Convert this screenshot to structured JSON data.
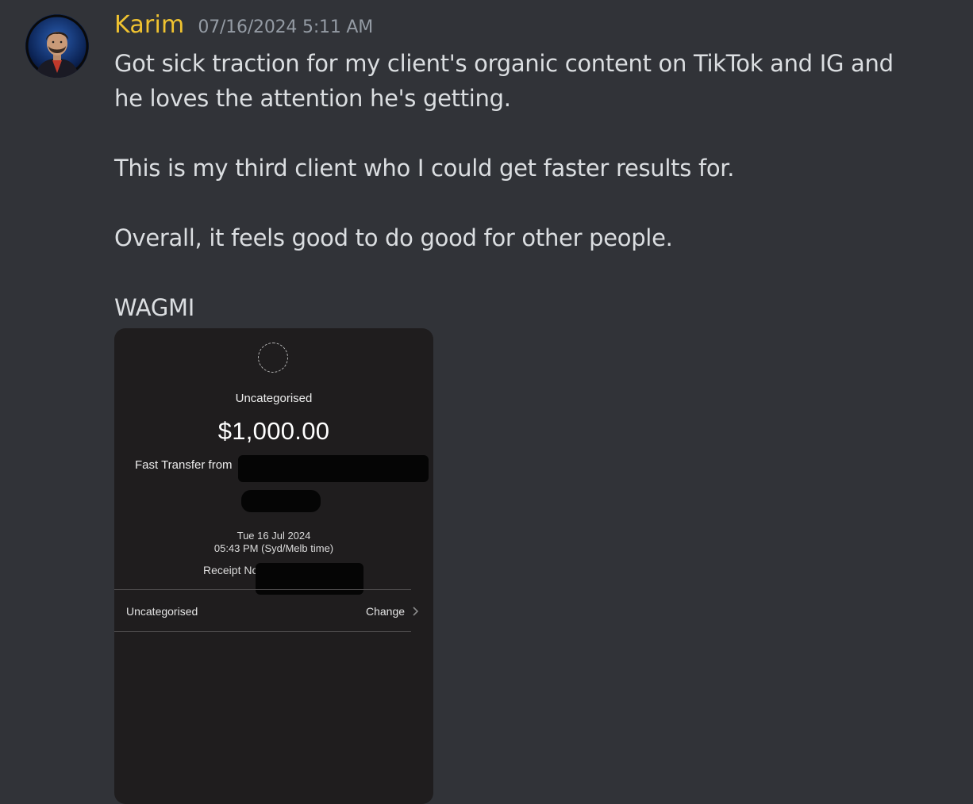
{
  "message": {
    "author": "Karim",
    "timestamp": "07/16/2024 5:11 AM",
    "paragraphs": [
      "Got sick traction for my client's organic content on TikTok and IG and he loves the attention he's getting.",
      "This is my third client who I could get faster results for.",
      "Overall, it feels good to do good for other people.",
      "WAGMI"
    ]
  },
  "attachment": {
    "category": "Uncategorised",
    "amount": "$1,000.00",
    "transfer_label": "Fast Transfer from",
    "date": "Tue 16 Jul 2024",
    "time": "05:43 PM (Syd/Melb time)",
    "receipt_label": "Receipt No",
    "row_label": "Uncategorised",
    "change_label": "Change",
    "icons": {
      "category": "category-placeholder-icon",
      "change": "chevron-right-icon"
    }
  },
  "colors": {
    "background": "#313338",
    "username": "#f0c330",
    "timestamp": "#949ba4",
    "text": "#dbdee1",
    "attachment_bg": "#1f1d1e"
  }
}
